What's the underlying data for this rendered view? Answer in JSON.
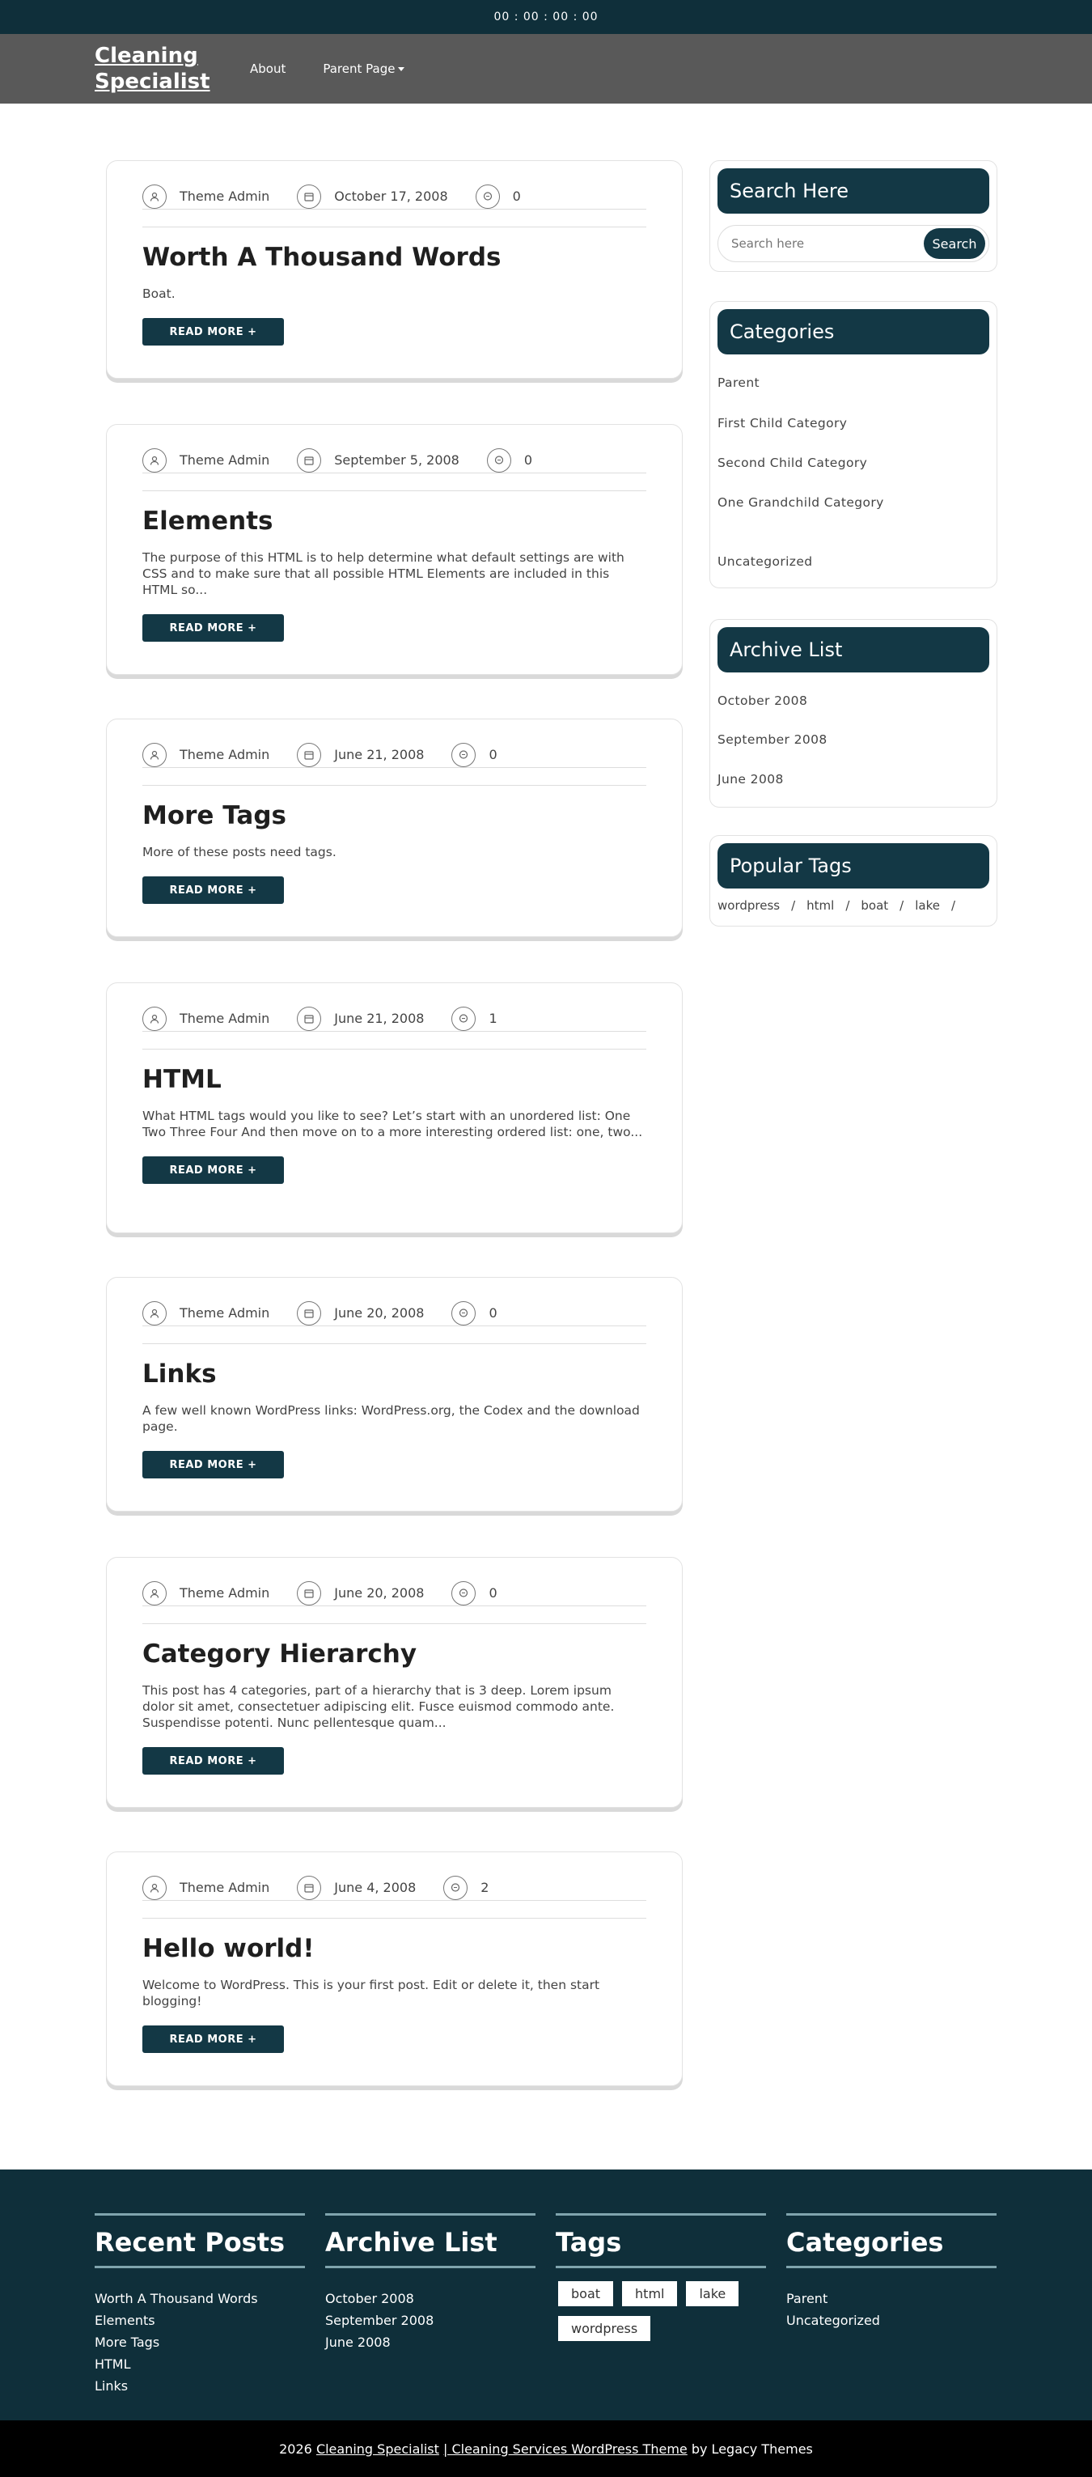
{
  "topbar": {
    "timer": "00 : 00 : 00 : 00"
  },
  "header": {
    "logo": "Cleaning Specialist",
    "nav": [
      {
        "label": "About"
      },
      {
        "label": "Parent Page"
      }
    ]
  },
  "posts": [
    {
      "author": "Theme Admin",
      "date": "October 17, 2008",
      "comments": "0",
      "title": "Worth A Thousand Words",
      "excerpt": "Boat.",
      "readmore": "READ MORE +"
    },
    {
      "author": "Theme Admin",
      "date": "September 5, 2008",
      "comments": "0",
      "title": "Elements",
      "excerpt": "The purpose of this HTML is to help determine what default settings are with CSS and to make sure that all possible HTML Elements are included in this HTML so...",
      "readmore": "READ MORE +"
    },
    {
      "author": "Theme Admin",
      "date": "June 21, 2008",
      "comments": "0",
      "title": "More Tags",
      "excerpt": "More of these posts need tags.",
      "readmore": "READ MORE +"
    },
    {
      "author": "Theme Admin",
      "date": "June 21, 2008",
      "comments": "1",
      "title": "HTML",
      "excerpt": "What HTML tags would you like to see? Let’s start with an unordered list: One Two Three Four And then move on to a more interesting ordered list: one, two...",
      "readmore": "READ MORE +"
    },
    {
      "author": "Theme Admin",
      "date": "June 20, 2008",
      "comments": "0",
      "title": "Links",
      "excerpt": "A few well known WordPress links: WordPress.org, the Codex and the download page.",
      "readmore": "READ MORE +"
    },
    {
      "author": "Theme Admin",
      "date": "June 20, 2008",
      "comments": "0",
      "title": "Category Hierarchy",
      "excerpt": "This post has 4 categories, part of a hierarchy that is 3 deep. Lorem ipsum dolor sit amet, consectetuer adipiscing elit. Fusce euismod commodo ante. Suspendisse potenti. Nunc pellentesque quam...",
      "readmore": "READ MORE +"
    },
    {
      "author": "Theme Admin",
      "date": "June 4, 2008",
      "comments": "2",
      "title": "Hello world!",
      "excerpt": "Welcome to WordPress. This is your first post. Edit or delete it, then start blogging!",
      "readmore": "READ MORE +"
    }
  ],
  "sidebar": {
    "search": {
      "title": "Search Here",
      "placeholder": "Search here",
      "button": "Search"
    },
    "categories": {
      "title": "Categories",
      "items": [
        "Parent",
        "First Child Category",
        "Second Child Category",
        "One Grandchild Category",
        "Uncategorized"
      ]
    },
    "archive": {
      "title": "Archive List",
      "items": [
        "October 2008",
        "September 2008",
        "June 2008"
      ]
    },
    "tags": {
      "title": "Popular Tags",
      "items": [
        "wordpress",
        "html",
        "boat",
        "lake"
      ],
      "separator": "/"
    }
  },
  "footer": {
    "recent": {
      "title": "Recent Posts",
      "items": [
        "Worth A Thousand Words",
        "Elements",
        "More Tags",
        "HTML",
        "Links"
      ]
    },
    "archive": {
      "title": "Archive List",
      "items": [
        "October 2008",
        "September 2008",
        "June 2008"
      ]
    },
    "tags": {
      "title": "Tags",
      "items": [
        "boat",
        "html",
        "lake",
        "wordpress"
      ]
    },
    "categories": {
      "title": "Categories",
      "items": [
        "Parent",
        "Uncategorized"
      ]
    },
    "copyright": {
      "year": "2026",
      "site_link": "Cleaning Specialist",
      "theme_link": "| Cleaning Services WordPress Theme",
      "by": "by Legacy Themes"
    }
  },
  "colors": {
    "primary": "#133845",
    "topbar": "#0f2f3a",
    "header": "#595959"
  }
}
